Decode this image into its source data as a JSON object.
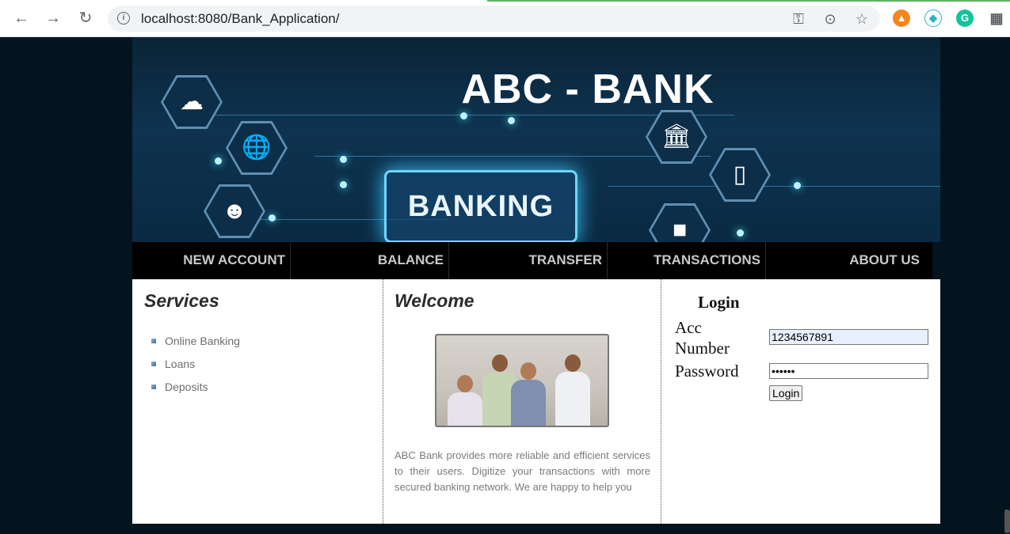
{
  "browser": {
    "url": "localhost:8080/Bank_Application/",
    "back_icon": "arrow-left",
    "forward_icon": "arrow-right",
    "reload_icon": "reload",
    "extensions": [
      "metamask-fox",
      "crystal-extension",
      "grammarly",
      "puzzle-extensions"
    ]
  },
  "banner": {
    "title": "ABC - BANK",
    "sign_text": "BANKING"
  },
  "menu": {
    "items": [
      "NEW ACCOUNT",
      "BALANCE",
      "TRANSFER",
      "TRANSACTIONS",
      "ABOUT US"
    ]
  },
  "services": {
    "heading": "Services",
    "items": [
      "Online Banking",
      "Loans",
      "Deposits"
    ]
  },
  "welcome": {
    "heading": "Welcome",
    "text": "ABC Bank provides more reliable and efficient services to their users. Digitize your transactions with more secured banking network. We are happy to help you"
  },
  "login": {
    "title": "Login",
    "acc_label_line1": "Acc",
    "acc_label_line2": "Number",
    "acc_value": "1234567891",
    "password_label": "Password",
    "password_value": "••••••",
    "button_label": "Login"
  },
  "colors": {
    "page_bg": "#04141f",
    "menu_bg": "#000000",
    "menu_text": "#c9c9c9",
    "autofill_bg": "#e8f0fe"
  }
}
